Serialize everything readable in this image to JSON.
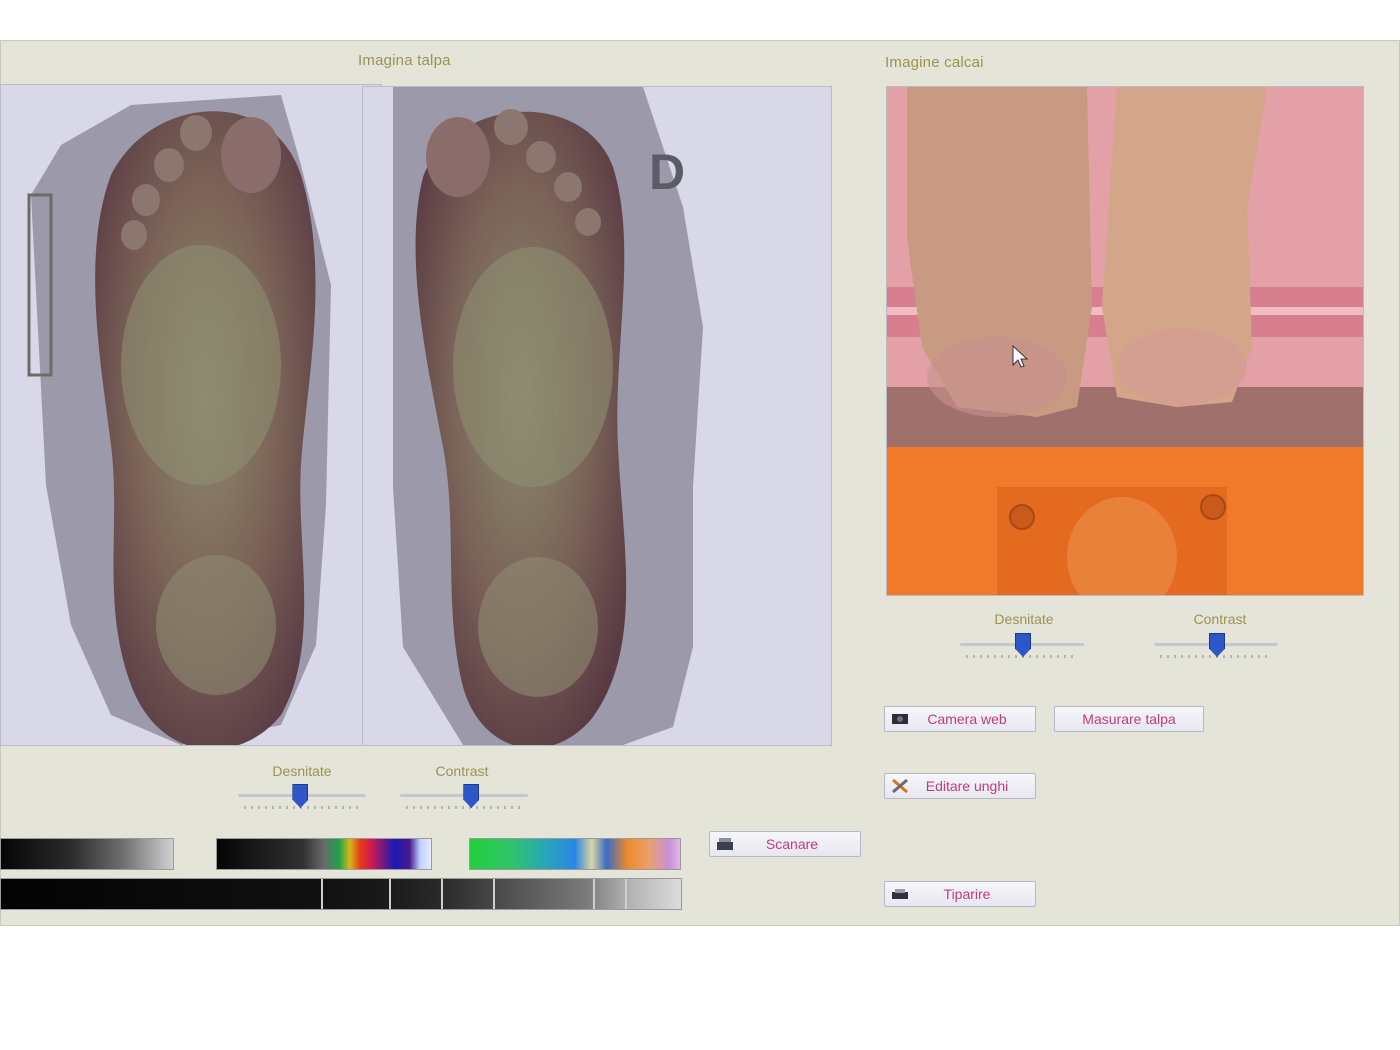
{
  "sections": {
    "sole_image_label": "Imagina talpa",
    "heel_image_label": "Imagine calcai"
  },
  "sole_controls": {
    "density_label": "Desnitate",
    "contrast_label": "Contrast",
    "density_value": 0.48,
    "contrast_value": 0.55
  },
  "heel_controls": {
    "density_label": "Desnitate",
    "contrast_label": "Contrast",
    "density_value": 0.5,
    "contrast_value": 0.5
  },
  "buttons": {
    "camera_web": "Camera web",
    "measure_sole": "Masurare talpa",
    "edit_angles": "Editare unghi",
    "scan": "Scanare",
    "print": "Tiparire"
  },
  "panel_letter": "D",
  "colors": {
    "accent_text": "#9a9350",
    "button_text": "#c43a7c",
    "slider_thumb": "#2d56c9"
  },
  "icons": {
    "camera": "webcam-icon",
    "edit": "tools-cross-icon",
    "scan": "scanner-icon",
    "print": "printer-icon"
  }
}
